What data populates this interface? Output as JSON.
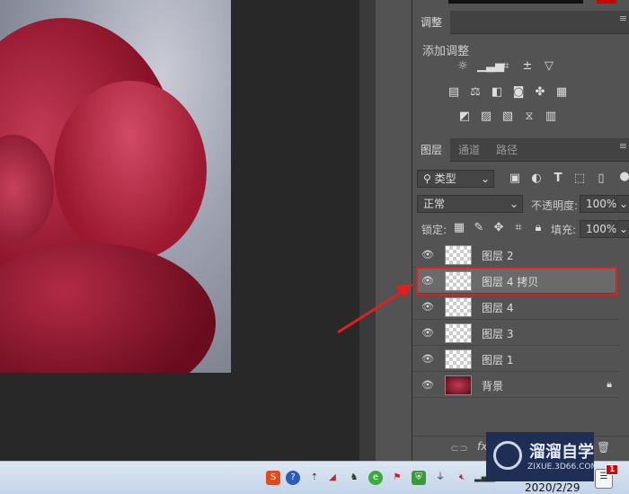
{
  "adjustments": {
    "tab": "调整",
    "title": "添加调整",
    "icons_row1": [
      "brightness-icon",
      "levels-icon",
      "curves-icon",
      "exposure-icon",
      "vibrance-icon"
    ],
    "icons_row2": [
      "hue-saturation-icon",
      "color-balance-icon",
      "black-white-icon",
      "photo-filter-icon",
      "channel-mixer-icon",
      "color-lookup-icon"
    ],
    "icons_row3": [
      "invert-icon",
      "posterize-icon",
      "threshold-icon",
      "selective-color-icon",
      "gradient-map-icon"
    ]
  },
  "layers_panel": {
    "tabs": [
      "图层",
      "通道",
      "路径"
    ],
    "filter_kind": "类型",
    "blend_mode": "正常",
    "opacity_label": "不透明度:",
    "opacity": "100%",
    "lock_label": "锁定:",
    "fill_label": "填充:",
    "fill": "100%",
    "layers": [
      {
        "name": "图层 2",
        "visible": true,
        "selected": false
      },
      {
        "name": "图层 4 拷贝",
        "visible": true,
        "selected": true
      },
      {
        "name": "图层 4",
        "visible": true,
        "selected": false
      },
      {
        "name": "图层 3",
        "visible": true,
        "selected": false
      },
      {
        "name": "图层 1",
        "visible": true,
        "selected": false
      },
      {
        "name": "背景",
        "visible": true,
        "selected": false,
        "locked": true
      }
    ],
    "footer_fx": "fx"
  },
  "annotation": {
    "color": "#e02020"
  },
  "watermark": {
    "title": "溜溜自学",
    "url": "ZIXUE.3D66.COM"
  },
  "taskbar": {
    "date": "2020/2/29",
    "notification_count": "1"
  }
}
